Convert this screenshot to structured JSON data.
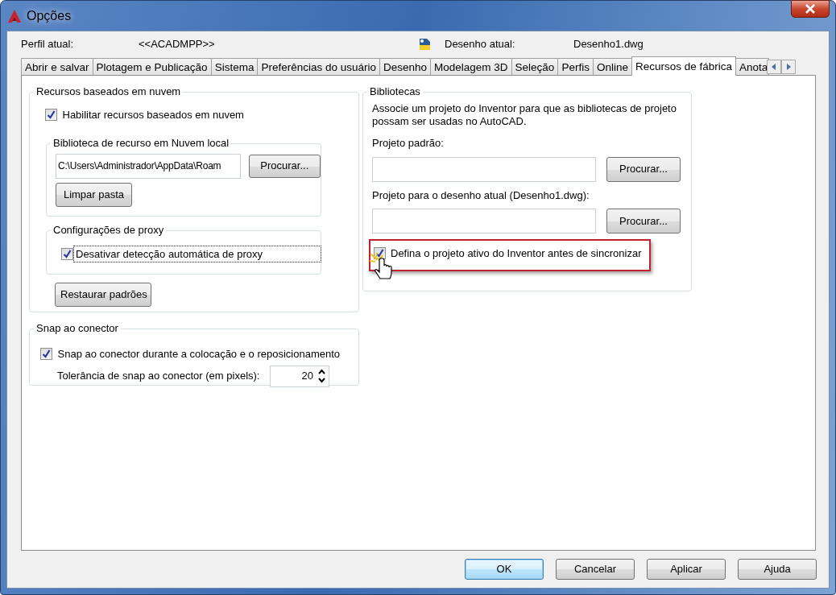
{
  "window": {
    "title": "Opções"
  },
  "header": {
    "profile_label": "Perfil atual:",
    "profile_value": "<<ACADMPP>>",
    "drawing_label": "Desenho atual:",
    "drawing_value": "Desenho1.dwg"
  },
  "tabs": [
    {
      "label": "Abrir e salvar",
      "selected": false
    },
    {
      "label": "Plotagem e Publicação",
      "selected": false
    },
    {
      "label": "Sistema",
      "selected": false
    },
    {
      "label": "Preferências do usuário",
      "selected": false
    },
    {
      "label": "Desenho",
      "selected": false
    },
    {
      "label": "Modelagem 3D",
      "selected": false
    },
    {
      "label": "Seleção",
      "selected": false
    },
    {
      "label": "Perfis",
      "selected": false
    },
    {
      "label": "Online",
      "selected": false
    },
    {
      "label": "Recursos de fábrica",
      "selected": true
    },
    {
      "label": "Anota",
      "selected": false
    }
  ],
  "cloud": {
    "title": "Recursos baseados em nuvem",
    "enable": {
      "label": "Habilitar recursos baseados em nuvem",
      "checked": true
    },
    "library": {
      "title": "Biblioteca de recurso em Nuvem local",
      "path": "C:\\Users\\Administrador\\AppData\\Roam",
      "browse": "Procurar...",
      "clear": "Limpar pasta"
    },
    "proxy": {
      "title": "Configurações de proxy",
      "label": "Desativar detecção automática de proxy",
      "checked": true,
      "focused": true
    },
    "restore": "Restaurar padrões"
  },
  "snap": {
    "title": "Snap ao conector",
    "label": "Snap ao conector durante a colocação e o reposicionamento",
    "checked": true,
    "tolerance_label": "Tolerância de snap ao conector (em pixels):",
    "tolerance_value": "20"
  },
  "libraries": {
    "title": "Bibliotecas",
    "description": "Associe um projeto do Inventor para que as bibliotecas de projeto possam ser usadas no AutoCAD.",
    "default_label": "Projeto padrão:",
    "default_browse": "Procurar...",
    "current_label": "Projeto para o desenho atual (Desenho1.dwg):",
    "current_browse": "Procurar...",
    "active": {
      "label": "Defina o projeto ativo do Inventor antes de sincronizar",
      "checked": true,
      "highlighted": true
    }
  },
  "buttons": [
    {
      "label": "OK",
      "default": true
    },
    {
      "label": "Cancelar",
      "default": false
    },
    {
      "label": "Aplicar",
      "default": false
    },
    {
      "label": "Ajuda",
      "default": false
    }
  ]
}
